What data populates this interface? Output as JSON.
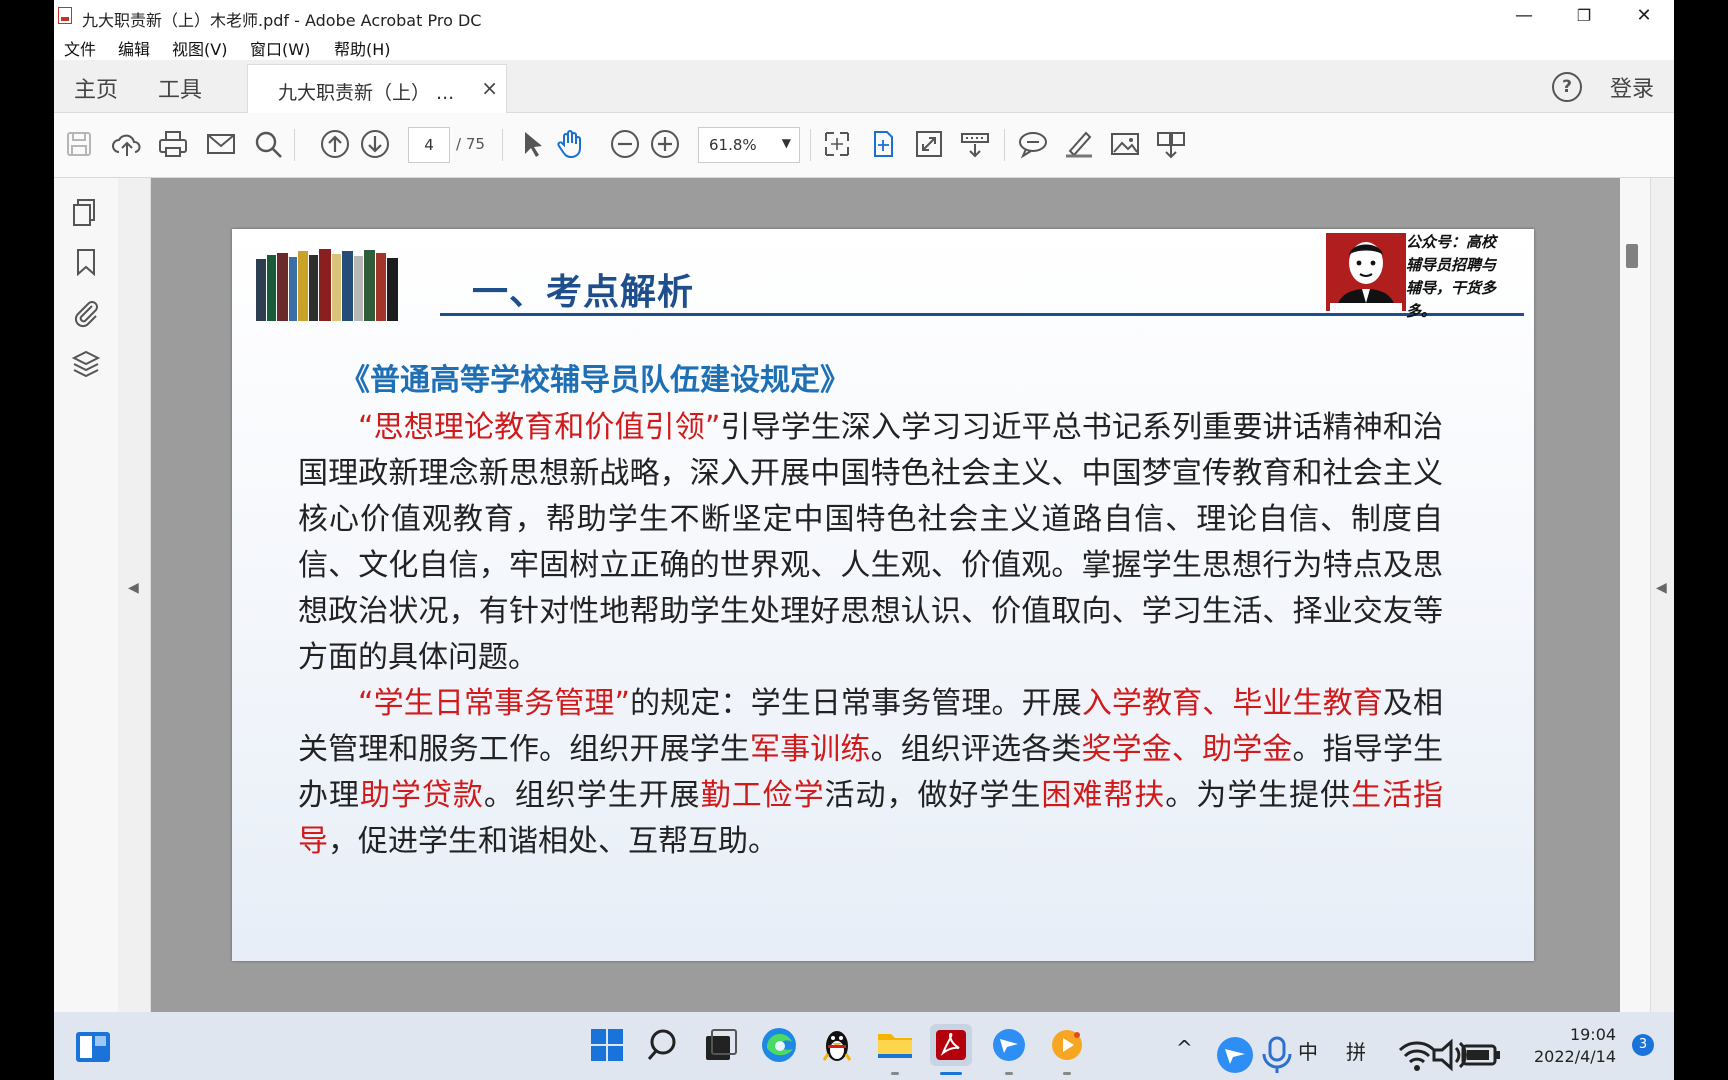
{
  "window": {
    "title": "九大职责新（上）木老师.pdf - Adobe Acrobat Pro DC",
    "minimize": "—",
    "maximize": "❐",
    "close": "✕"
  },
  "menu": [
    "文件",
    "编辑",
    "视图(V)",
    "窗口(W)",
    "帮助(H)"
  ],
  "tabs": {
    "home": "主页",
    "tools": "工具",
    "doc": "九大职责新（上） ...",
    "close": "×",
    "help": "?",
    "login": "登录"
  },
  "toolbar": {
    "page_current": "4",
    "page_total": "/ 75",
    "zoom": "61.8%",
    "zoom_arrow": "▼"
  },
  "panels": {
    "left_arrow": "◀",
    "right_arrow": "◀"
  },
  "slide": {
    "heading": "一、考点解析",
    "wechat_text": "公众号：高校辅导员招聘与辅导，干货多多。",
    "subtitle": "《普通高等学校辅导员队伍建设规定》",
    "p1_red": "“思想理论教育和价值引领”",
    "p1_text": "引导学生深入学习习近平总书记系列重要讲话精神和治国理政新理念新思想新战略，深入开展中国特色社会主义、中国梦宣传教育和社会主义核心价值观教育，帮助学生不断坚定中国特色社会主义道路自信、理论自信、制度自信、文化自信，牢固树立正确的世界观、人生观、价值观。掌握学生思想行为特点及思想政治状况，有针对性地帮助学生处理好思想认识、价值取向、学习生活、择业交友等方面的具体问题。",
    "p2_red1": "“学生日常事务管理”",
    "p2_t1": "的规定：学生日常事务管理。开展",
    "p2_red2": "入学教育、毕业生教育",
    "p2_t2": "及相关管理和服务工作。组织开展学生",
    "p2_red3": "军事训练",
    "p2_t3": "。组织评选各类",
    "p2_red4": "奖学金、助学金",
    "p2_t4": "。指导学生办理",
    "p2_red5": "助学贷款",
    "p2_t5": "。组织学生开展",
    "p2_red6": "勤工俭学",
    "p2_t6": "活动，做好学生",
    "p2_red7": "困难帮扶",
    "p2_t7": "。为学生提供",
    "p2_red8": "生活指导",
    "p2_t8": "，促进学生和谐相处、互帮互助。"
  },
  "taskbar": {
    "tray_up": "^",
    "ime_zh": "中",
    "ime_pin": "拼",
    "time": "19:04",
    "date": "2022/4/14",
    "notifications": "3"
  },
  "colors": {
    "heading_blue": "#1f4e8c",
    "subtitle_blue": "#1f6fb5",
    "emphasis_red": "#d11a1a"
  }
}
